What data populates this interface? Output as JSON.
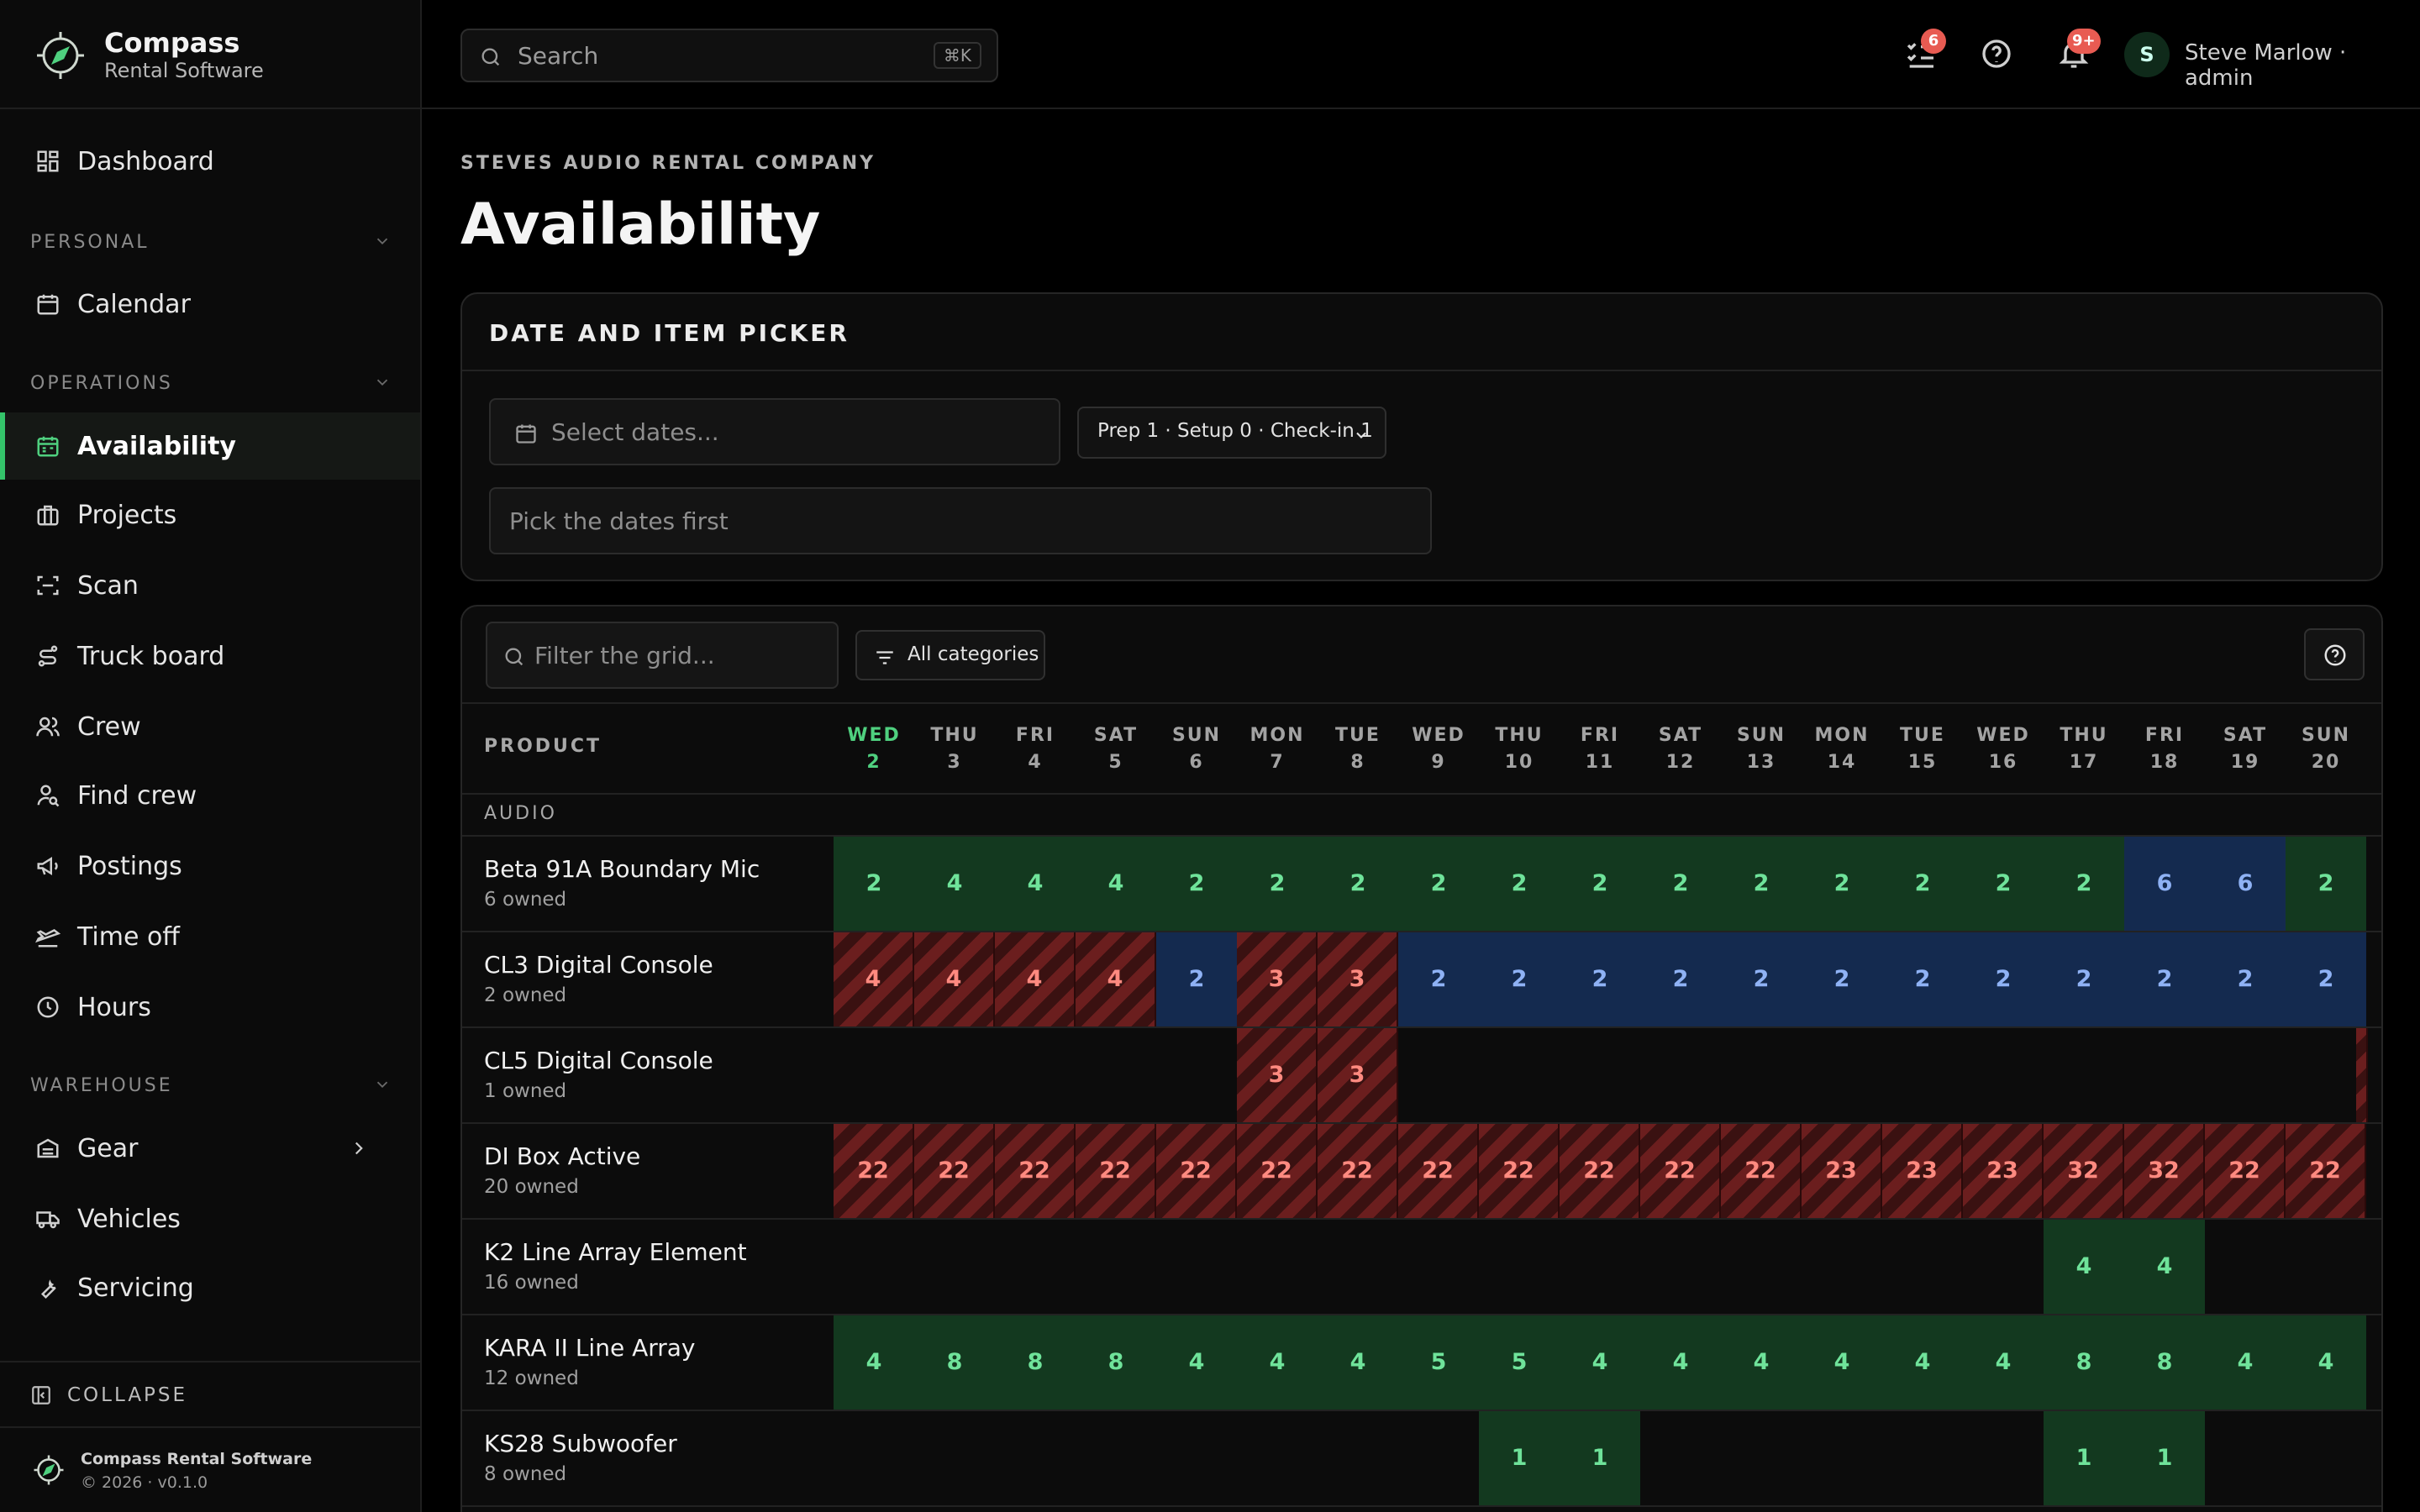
{
  "brand": {
    "name": "Compass",
    "subtitle": "Rental Software"
  },
  "sidebar": {
    "dashboard": "Dashboard",
    "sections": {
      "personal": "PERSONAL",
      "operations": "OPERATIONS",
      "warehouse": "WAREHOUSE"
    },
    "personal_items": [
      {
        "label": "Calendar",
        "icon": "calendar-icon"
      }
    ],
    "operations_items": [
      {
        "label": "Availability",
        "icon": "availability-icon",
        "active": true
      },
      {
        "label": "Projects",
        "icon": "briefcase-icon"
      },
      {
        "label": "Scan",
        "icon": "scan-icon"
      },
      {
        "label": "Truck board",
        "icon": "route-icon"
      },
      {
        "label": "Crew",
        "icon": "users-icon"
      },
      {
        "label": "Find crew",
        "icon": "user-search-icon"
      },
      {
        "label": "Postings",
        "icon": "megaphone-icon"
      },
      {
        "label": "Time off",
        "icon": "plane-icon"
      },
      {
        "label": "Hours",
        "icon": "clock-icon"
      }
    ],
    "warehouse_items": [
      {
        "label": "Gear",
        "icon": "gear-box-icon"
      },
      {
        "label": "Vehicles",
        "icon": "truck-icon"
      },
      {
        "label": "Servicing",
        "icon": "wrench-icon"
      }
    ],
    "collapse": "COLLAPSE",
    "footer": {
      "title": "Compass Rental Software",
      "version": "© 2026 · v0.1.0"
    }
  },
  "topbar": {
    "search_placeholder": "Search",
    "search_shortcut": "⌘K",
    "tasks_badge": "6",
    "notifications_badge": "9+",
    "avatar_initial": "S",
    "user": "Steve Marlow · admin"
  },
  "page": {
    "company": "STEVES AUDIO RENTAL COMPANY",
    "title": "Availability"
  },
  "picker": {
    "title": "DATE AND ITEM PICKER",
    "dates_placeholder": "Select dates...",
    "prep_label": "Prep 1 · Setup 0 · Check-in 1",
    "items_placeholder": "Pick the dates first"
  },
  "grid": {
    "filter_placeholder": "Filter the grid...",
    "categories_label": "All categories",
    "product_header": "PRODUCT",
    "category": "AUDIO",
    "days": [
      {
        "dow": "WED",
        "day": "2",
        "today": true
      },
      {
        "dow": "THU",
        "day": "3"
      },
      {
        "dow": "FRI",
        "day": "4"
      },
      {
        "dow": "SAT",
        "day": "5"
      },
      {
        "dow": "SUN",
        "day": "6"
      },
      {
        "dow": "MON",
        "day": "7"
      },
      {
        "dow": "TUE",
        "day": "8"
      },
      {
        "dow": "WED",
        "day": "9"
      },
      {
        "dow": "THU",
        "day": "10"
      },
      {
        "dow": "FRI",
        "day": "11"
      },
      {
        "dow": "SAT",
        "day": "12"
      },
      {
        "dow": "SUN",
        "day": "13"
      },
      {
        "dow": "MON",
        "day": "14"
      },
      {
        "dow": "TUE",
        "day": "15"
      },
      {
        "dow": "WED",
        "day": "16"
      },
      {
        "dow": "THU",
        "day": "17"
      },
      {
        "dow": "FRI",
        "day": "18"
      },
      {
        "dow": "SAT",
        "day": "19"
      },
      {
        "dow": "SUN",
        "day": "20"
      }
    ],
    "status_colors": {
      "available": "#13391f",
      "reserved": "#142a4f",
      "overbooked": "#6b1e1e"
    },
    "rows": [
      {
        "name": "Beta 91A Boundary Mic",
        "owned": "6 owned",
        "cells": [
          [
            "g",
            "2"
          ],
          [
            "g",
            "4"
          ],
          [
            "g",
            "4"
          ],
          [
            "g",
            "4"
          ],
          [
            "g",
            "2"
          ],
          [
            "g",
            "2"
          ],
          [
            "g",
            "2"
          ],
          [
            "g",
            "2"
          ],
          [
            "g",
            "2"
          ],
          [
            "g",
            "2"
          ],
          [
            "g",
            "2"
          ],
          [
            "g",
            "2"
          ],
          [
            "g",
            "2"
          ],
          [
            "g",
            "2"
          ],
          [
            "g",
            "2"
          ],
          [
            "g",
            "2"
          ],
          [
            "b",
            "6"
          ],
          [
            "b",
            "6"
          ],
          [
            "g",
            "2"
          ]
        ]
      },
      {
        "name": "CL3 Digital Console",
        "owned": "2 owned",
        "cells": [
          [
            "r",
            "4"
          ],
          [
            "r",
            "4"
          ],
          [
            "r",
            "4"
          ],
          [
            "r",
            "4"
          ],
          [
            "b",
            "2"
          ],
          [
            "r",
            "3"
          ],
          [
            "r",
            "3"
          ],
          [
            "b",
            "2"
          ],
          [
            "b",
            "2"
          ],
          [
            "b",
            "2"
          ],
          [
            "b",
            "2"
          ],
          [
            "b",
            "2"
          ],
          [
            "b",
            "2"
          ],
          [
            "b",
            "2"
          ],
          [
            "b",
            "2"
          ],
          [
            "b",
            "2"
          ],
          [
            "b",
            "2"
          ],
          [
            "b",
            "2"
          ],
          [
            "b",
            "2"
          ]
        ]
      },
      {
        "name": "CL5 Digital Console",
        "owned": "1 owned",
        "cells": [
          null,
          null,
          null,
          null,
          null,
          [
            "r",
            "3"
          ],
          [
            "r",
            "3"
          ],
          null,
          null,
          null,
          null,
          null,
          null,
          null,
          null,
          null,
          null,
          null,
          [
            "r",
            ""
          ]
        ]
      },
      {
        "name": "DI Box Active",
        "owned": "20 owned",
        "cells": [
          [
            "r",
            "22"
          ],
          [
            "r",
            "22"
          ],
          [
            "r",
            "22"
          ],
          [
            "r",
            "22"
          ],
          [
            "r",
            "22"
          ],
          [
            "r",
            "22"
          ],
          [
            "r",
            "22"
          ],
          [
            "r",
            "22"
          ],
          [
            "r",
            "22"
          ],
          [
            "r",
            "22"
          ],
          [
            "r",
            "22"
          ],
          [
            "r",
            "22"
          ],
          [
            "r",
            "23"
          ],
          [
            "r",
            "23"
          ],
          [
            "r",
            "23"
          ],
          [
            "r",
            "32"
          ],
          [
            "r",
            "32"
          ],
          [
            "r",
            "22"
          ],
          [
            "r",
            "22"
          ]
        ]
      },
      {
        "name": "K2 Line Array Element",
        "owned": "16 owned",
        "cells": [
          null,
          null,
          null,
          null,
          null,
          null,
          null,
          null,
          null,
          null,
          null,
          null,
          null,
          null,
          null,
          [
            "g",
            "4"
          ],
          [
            "g",
            "4"
          ],
          null,
          null
        ]
      },
      {
        "name": "KARA II Line Array",
        "owned": "12 owned",
        "cells": [
          [
            "g",
            "4"
          ],
          [
            "g",
            "8"
          ],
          [
            "g",
            "8"
          ],
          [
            "g",
            "8"
          ],
          [
            "g",
            "4"
          ],
          [
            "g",
            "4"
          ],
          [
            "g",
            "4"
          ],
          [
            "g",
            "5"
          ],
          [
            "g",
            "5"
          ],
          [
            "g",
            "4"
          ],
          [
            "g",
            "4"
          ],
          [
            "g",
            "4"
          ],
          [
            "g",
            "4"
          ],
          [
            "g",
            "4"
          ],
          [
            "g",
            "4"
          ],
          [
            "g",
            "8"
          ],
          [
            "g",
            "8"
          ],
          [
            "g",
            "4"
          ],
          [
            "g",
            "4"
          ]
        ]
      },
      {
        "name": "KS28 Subwoofer",
        "owned": "8 owned",
        "cells": [
          null,
          null,
          null,
          null,
          null,
          null,
          null,
          null,
          [
            "g",
            "1"
          ],
          [
            "g",
            "1"
          ],
          null,
          null,
          null,
          null,
          null,
          [
            "g",
            "1"
          ],
          [
            "g",
            "1"
          ],
          null,
          null
        ]
      }
    ]
  }
}
